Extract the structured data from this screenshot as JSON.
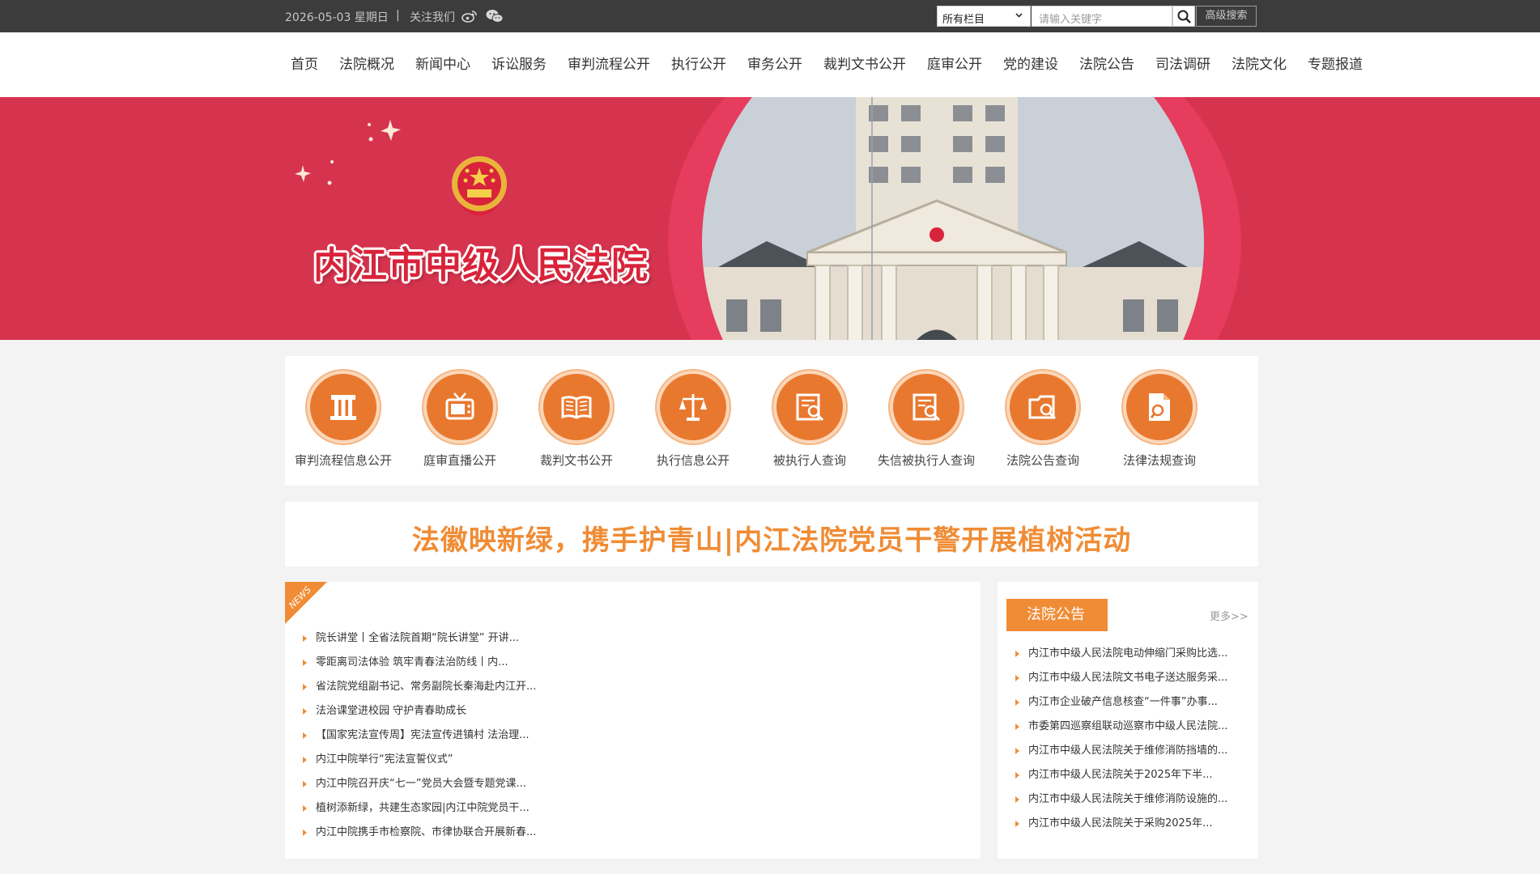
{
  "topbar": {
    "date": "2026-05-03 星期日",
    "separator": "|",
    "follow_label": "关注我们",
    "icons": [
      "weibo-icon",
      "wechat-icon"
    ],
    "search_select": "所有栏目",
    "search_placeholder": "请输入关键字",
    "advanced_search": "高级搜索"
  },
  "nav": {
    "items": [
      {
        "label": "首页"
      },
      {
        "label": "法院概况"
      },
      {
        "label": "新闻中心"
      },
      {
        "label": "诉讼服务"
      },
      {
        "label": "审判流程公开"
      },
      {
        "label": "执行公开"
      },
      {
        "label": "审务公开"
      },
      {
        "label": "裁判文书公开"
      },
      {
        "label": "庭审公开"
      },
      {
        "label": "党的建设"
      },
      {
        "label": "法院公告"
      },
      {
        "label": "司法调研"
      },
      {
        "label": "法院文化"
      },
      {
        "label": "专题报道"
      }
    ]
  },
  "banner": {
    "court_name": "内江市中级人民法院"
  },
  "quick_links": {
    "items": [
      {
        "label": "审判流程信息公开",
        "icon": "pillar-icon"
      },
      {
        "label": "庭审直播公开",
        "icon": "tv-icon"
      },
      {
        "label": "裁判文书公开",
        "icon": "book-icon"
      },
      {
        "label": "执行信息公开",
        "icon": "scales-icon"
      },
      {
        "label": "被执行人查询",
        "icon": "document-search-icon"
      },
      {
        "label": "失信被执行人查询",
        "icon": "document-search-icon"
      },
      {
        "label": "法院公告查询",
        "icon": "folder-search-icon"
      },
      {
        "label": "法律法规查询",
        "icon": "file-search-icon"
      }
    ]
  },
  "headline": {
    "text": "法徽映新绿，携手护青山|内江法院党员干警开展植树活动"
  },
  "news": {
    "tag": "NEWS",
    "items": [
      "院长讲堂丨全省法院首期“院长讲堂” 开讲...",
      "零距离司法体验 筑牢青春法治防线丨内...",
      "省法院党组副书记、常务副院长秦海赴内江开...",
      "法治课堂进校园 守护青春助成长",
      "【国家宪法宣传周】宪法宣传进镇村 法治理...",
      "内江中院举行“宪法宣誓仪式”",
      "内江中院召开庆“七一”党员大会暨专题党课...",
      "植树添新绿，共建生态家园|内江中院党员干...",
      "内江中院携手市检察院、市律协联合开展新春..."
    ]
  },
  "notices": {
    "title": "法院公告",
    "more": "更多>>",
    "items": [
      "内江市中级人民法院电动伸缩门采购比选...",
      "内江市中级人民法院文书电子送达服务采...",
      "内江市企业破产信息核查“一件事”办事...",
      "市委第四巡察组联动巡察市中级人民法院...",
      "内江市中级人民法院关于维修消防挡墙的...",
      "内江市中级人民法院关于2025年下半...",
      "内江市中级人民法院关于维修消防设施的...",
      "内江市中级人民法院关于采购2025年..."
    ]
  },
  "colors": {
    "topbar_bg": "#3c3c3c",
    "banner_red": "#d6334e",
    "accent_orange": "#f08c35",
    "page_bg": "#f3f3f3"
  }
}
